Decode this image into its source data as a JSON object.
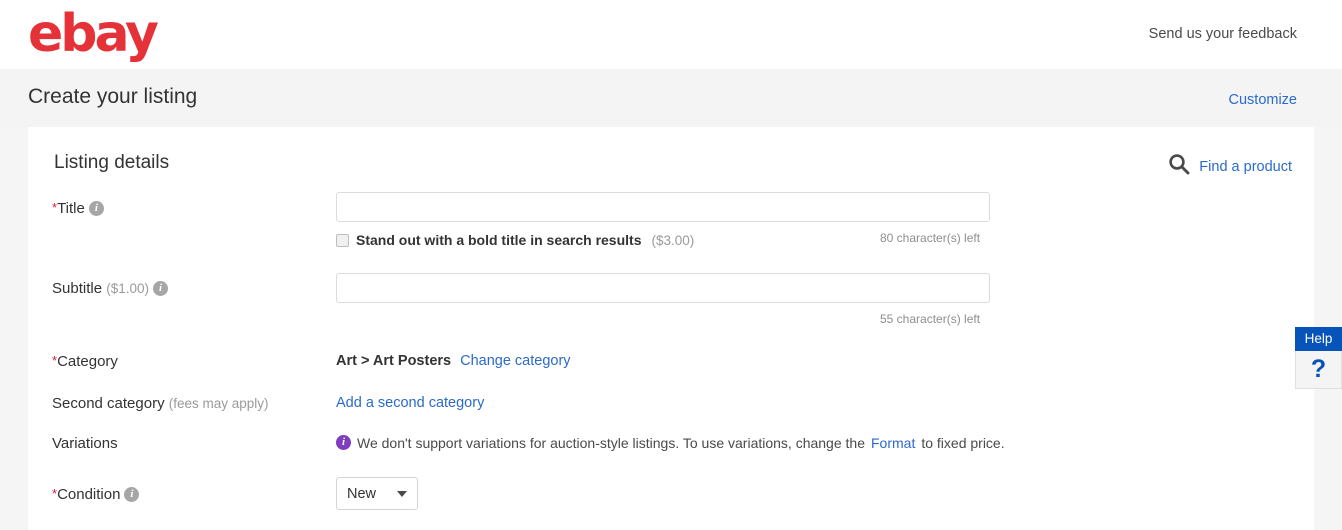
{
  "header": {
    "logo_text": "ebay",
    "logo_color": "#e53238",
    "feedback_label": "Send us your feedback"
  },
  "page": {
    "title": "Create your listing",
    "customize_label": "Customize"
  },
  "listing_details": {
    "section_title": "Listing details",
    "find_product_label": "Find a product",
    "find_product_icon": "search-icon",
    "title_row": {
      "label": "Title",
      "required_marker": "*",
      "info_icon": "info-icon",
      "input_value": "",
      "input_placeholder": "",
      "bold_checkbox_label": "Stand out with a bold title in search results",
      "bold_checkbox_price": "($3.00)",
      "bold_checkbox_checked": false,
      "char_count": "80 character(s) left"
    },
    "subtitle_row": {
      "label": "Subtitle",
      "price": "($1.00)",
      "info_icon": "info-icon",
      "input_value": "",
      "input_placeholder": "",
      "char_count": "55 character(s) left"
    },
    "category_row": {
      "label": "Category",
      "required_marker": "*",
      "value": "Art > Art Posters",
      "change_link": "Change category"
    },
    "second_category_row": {
      "label": "Second category",
      "note": "(fees may apply)",
      "add_link": "Add a second category"
    },
    "variations_row": {
      "label": "Variations",
      "info_icon": "info-icon-purple",
      "info_color": "#7e3ebd",
      "message_part1": "We don't support variations for auction-style listings. To use variations, change the",
      "message_link": "Format",
      "message_part2": "to fixed price."
    },
    "condition_row": {
      "label": "Condition",
      "required_marker": "*",
      "info_icon": "info-icon",
      "selected_value": "New"
    }
  },
  "help_widget": {
    "header_label": "Help",
    "question_mark": "?",
    "accent_color": "#0654ba"
  }
}
